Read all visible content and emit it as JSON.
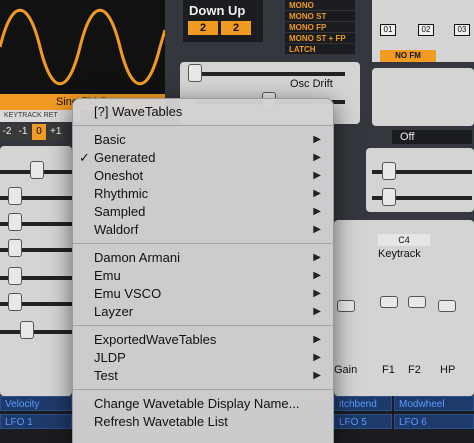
{
  "background": {
    "osc": {
      "wave_label": "Sine FM Sc ...",
      "keytrack_strip": "KEYTRACK  RET",
      "octave_values": [
        "-2",
        "-1",
        "0",
        "+1"
      ],
      "octave_selected": "0"
    },
    "down_up": {
      "title": "Down Up",
      "values": [
        "2",
        "2"
      ]
    },
    "mono_modes": [
      "MONO",
      "MONO ST",
      "MONO FP",
      "MONO ST + FP",
      "LATCH"
    ],
    "fm_boxes": [
      "01",
      "02",
      "03"
    ],
    "fm_mode": "NO FM",
    "osc_drift_label": "Osc Drift",
    "filter_off": "Off",
    "keytrack": {
      "note": "C4",
      "label": "Keytrack"
    },
    "bottom_labels": [
      "Gain",
      "F1",
      "F2",
      "HP"
    ],
    "mod_bar": {
      "top": [
        "Velocity",
        "itchbend",
        "Modwheel"
      ],
      "bottom": [
        "LFO 1",
        "LFO 5",
        "LFO 6"
      ]
    }
  },
  "menu": {
    "header": "[?] WaveTables",
    "groups": [
      [
        {
          "label": "Basic",
          "submenu": true,
          "checked": false
        },
        {
          "label": "Generated",
          "submenu": true,
          "checked": true
        },
        {
          "label": "Oneshot",
          "submenu": true,
          "checked": false
        },
        {
          "label": "Rhythmic",
          "submenu": true,
          "checked": false
        },
        {
          "label": "Sampled",
          "submenu": true,
          "checked": false
        },
        {
          "label": "Waldorf",
          "submenu": true,
          "checked": false
        }
      ],
      [
        {
          "label": "Damon Armani",
          "submenu": true,
          "checked": false
        },
        {
          "label": "Emu",
          "submenu": true,
          "checked": false
        },
        {
          "label": "Emu VSCO",
          "submenu": true,
          "checked": false
        },
        {
          "label": "Layzer",
          "submenu": true,
          "checked": false
        }
      ],
      [
        {
          "label": "ExportedWaveTables",
          "submenu": true,
          "checked": false
        },
        {
          "label": "JLDP",
          "submenu": true,
          "checked": false
        },
        {
          "label": "Test",
          "submenu": true,
          "checked": false
        }
      ],
      [
        {
          "label": "Change Wavetable Display Name...",
          "submenu": false,
          "checked": false
        },
        {
          "label": "Refresh Wavetable List",
          "submenu": false,
          "checked": false
        }
      ]
    ],
    "check_glyph": "✓",
    "arrow_glyph": "▶"
  },
  "colors": {
    "accent": "#f19b23",
    "menu_bg": "#d2d2d4",
    "mod_blue": "#1e3a6a"
  }
}
